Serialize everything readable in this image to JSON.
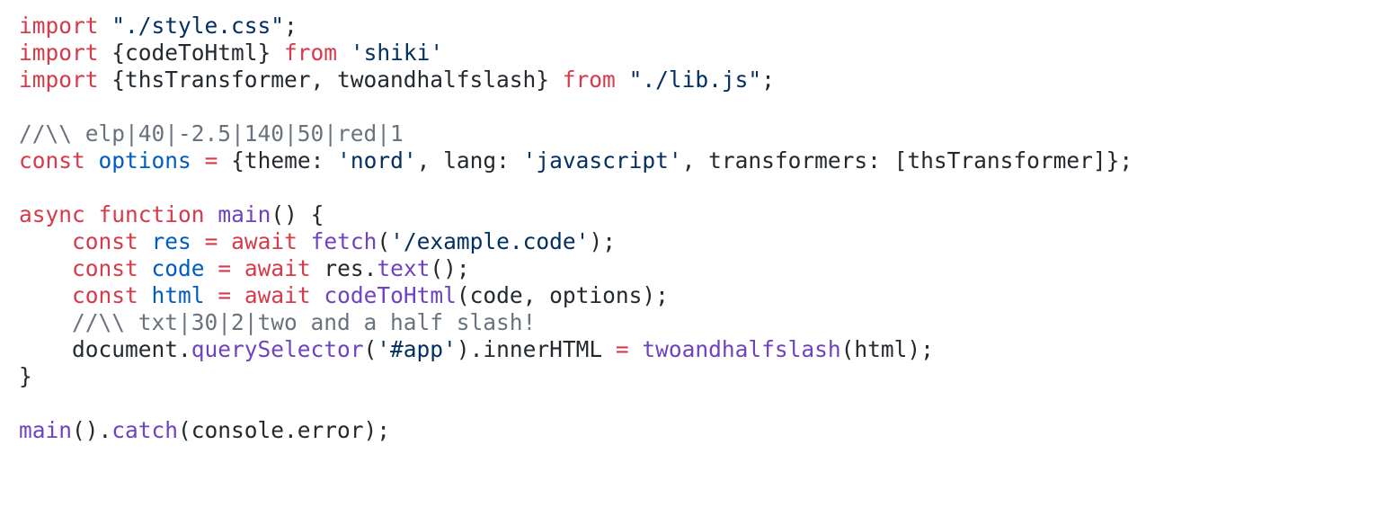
{
  "editor": {
    "background": "#ffffff",
    "colors": {
      "plain": "#24292e",
      "keyword": "#d73a49",
      "string": "#032f62",
      "function": "#6f42c1",
      "variable": "#005cc5",
      "comment": "#6a737d"
    },
    "lines": [
      [
        {
          "text": "import",
          "kind": "keyword"
        },
        {
          "text": " ",
          "kind": "plain"
        },
        {
          "text": "\"./style.css\"",
          "kind": "string"
        },
        {
          "text": ";",
          "kind": "plain"
        }
      ],
      [
        {
          "text": "import",
          "kind": "keyword"
        },
        {
          "text": " {codeToHtml} ",
          "kind": "plain"
        },
        {
          "text": "from",
          "kind": "keyword"
        },
        {
          "text": " ",
          "kind": "plain"
        },
        {
          "text": "'shiki'",
          "kind": "string"
        }
      ],
      [
        {
          "text": "import",
          "kind": "keyword"
        },
        {
          "text": " {thsTransformer, twoandhalfslash} ",
          "kind": "plain"
        },
        {
          "text": "from",
          "kind": "keyword"
        },
        {
          "text": " ",
          "kind": "plain"
        },
        {
          "text": "\"./lib.js\"",
          "kind": "string"
        },
        {
          "text": ";",
          "kind": "plain"
        }
      ],
      [],
      [
        {
          "text": "//\\\\ elp|40|-2.5|140|50|red|1",
          "kind": "comment"
        }
      ],
      [
        {
          "text": "const",
          "kind": "keyword"
        },
        {
          "text": " ",
          "kind": "plain"
        },
        {
          "text": "options",
          "kind": "variable"
        },
        {
          "text": " ",
          "kind": "plain"
        },
        {
          "text": "=",
          "kind": "keyword"
        },
        {
          "text": " {theme: ",
          "kind": "plain"
        },
        {
          "text": "'nord'",
          "kind": "string"
        },
        {
          "text": ", lang: ",
          "kind": "plain"
        },
        {
          "text": "'javascript'",
          "kind": "string"
        },
        {
          "text": ", transformers: [thsTransformer]};",
          "kind": "plain"
        }
      ],
      [],
      [
        {
          "text": "async",
          "kind": "keyword"
        },
        {
          "text": " ",
          "kind": "plain"
        },
        {
          "text": "function",
          "kind": "keyword"
        },
        {
          "text": " ",
          "kind": "plain"
        },
        {
          "text": "main",
          "kind": "function"
        },
        {
          "text": "() {",
          "kind": "plain"
        }
      ],
      [
        {
          "text": "    ",
          "kind": "plain"
        },
        {
          "text": "const",
          "kind": "keyword"
        },
        {
          "text": " ",
          "kind": "plain"
        },
        {
          "text": "res",
          "kind": "variable"
        },
        {
          "text": " ",
          "kind": "plain"
        },
        {
          "text": "=",
          "kind": "keyword"
        },
        {
          "text": " ",
          "kind": "plain"
        },
        {
          "text": "await",
          "kind": "keyword"
        },
        {
          "text": " ",
          "kind": "plain"
        },
        {
          "text": "fetch",
          "kind": "function"
        },
        {
          "text": "(",
          "kind": "plain"
        },
        {
          "text": "'/example.code'",
          "kind": "string"
        },
        {
          "text": ");",
          "kind": "plain"
        }
      ],
      [
        {
          "text": "    ",
          "kind": "plain"
        },
        {
          "text": "const",
          "kind": "keyword"
        },
        {
          "text": " ",
          "kind": "plain"
        },
        {
          "text": "code",
          "kind": "variable"
        },
        {
          "text": " ",
          "kind": "plain"
        },
        {
          "text": "=",
          "kind": "keyword"
        },
        {
          "text": " ",
          "kind": "plain"
        },
        {
          "text": "await",
          "kind": "keyword"
        },
        {
          "text": " res.",
          "kind": "plain"
        },
        {
          "text": "text",
          "kind": "function"
        },
        {
          "text": "();",
          "kind": "plain"
        }
      ],
      [
        {
          "text": "    ",
          "kind": "plain"
        },
        {
          "text": "const",
          "kind": "keyword"
        },
        {
          "text": " ",
          "kind": "plain"
        },
        {
          "text": "html",
          "kind": "variable"
        },
        {
          "text": " ",
          "kind": "plain"
        },
        {
          "text": "=",
          "kind": "keyword"
        },
        {
          "text": " ",
          "kind": "plain"
        },
        {
          "text": "await",
          "kind": "keyword"
        },
        {
          "text": " ",
          "kind": "plain"
        },
        {
          "text": "codeToHtml",
          "kind": "function"
        },
        {
          "text": "(code, options);",
          "kind": "plain"
        }
      ],
      [
        {
          "text": "    ",
          "kind": "plain"
        },
        {
          "text": "//\\\\ txt|30|2|two and a half slash!",
          "kind": "comment"
        }
      ],
      [
        {
          "text": "    document.",
          "kind": "plain"
        },
        {
          "text": "querySelector",
          "kind": "function"
        },
        {
          "text": "(",
          "kind": "plain"
        },
        {
          "text": "'#app'",
          "kind": "string"
        },
        {
          "text": ").innerHTML ",
          "kind": "plain"
        },
        {
          "text": "=",
          "kind": "keyword"
        },
        {
          "text": " ",
          "kind": "plain"
        },
        {
          "text": "twoandhalfslash",
          "kind": "function"
        },
        {
          "text": "(html);",
          "kind": "plain"
        }
      ],
      [
        {
          "text": "}",
          "kind": "plain"
        }
      ],
      [],
      [
        {
          "text": "main",
          "kind": "function"
        },
        {
          "text": "().",
          "kind": "plain"
        },
        {
          "text": "catch",
          "kind": "function"
        },
        {
          "text": "(console.error);",
          "kind": "plain"
        }
      ]
    ]
  }
}
